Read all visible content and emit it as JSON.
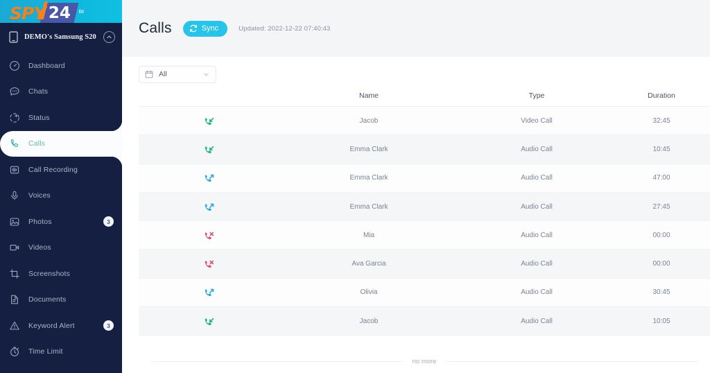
{
  "brand": {
    "logo_spy": "SPY",
    "logo_24": "24",
    "logo_superscript": "to",
    "logo_bg_color": "#11b6dd",
    "logo_spy_color": "#f5811f",
    "logo_badge_color": "#4857a8"
  },
  "sidebar": {
    "bg_color": "#151f42",
    "device": {
      "name": "DEMO's Samsung S20",
      "icon": "mobile-device-icon",
      "caret_icon": "chevron-up-icon"
    },
    "items": [
      {
        "label": "Dashboard",
        "icon": "dashboard-icon",
        "badge": "",
        "active": false
      },
      {
        "label": "Chats",
        "icon": "chat-bubble-icon",
        "badge": "",
        "active": false
      },
      {
        "label": "Status",
        "icon": "status-plus-icon",
        "badge": "",
        "active": false
      },
      {
        "label": "Calls",
        "icon": "phone-icon",
        "badge": "",
        "active": true
      },
      {
        "label": "Call Recording",
        "icon": "waveform-icon",
        "badge": "",
        "active": false
      },
      {
        "label": "Voices",
        "icon": "microphone-icon",
        "badge": "",
        "active": false
      },
      {
        "label": "Photos",
        "icon": "image-icon",
        "badge": "3",
        "active": false
      },
      {
        "label": "Videos",
        "icon": "video-camera-icon",
        "badge": "",
        "active": false
      },
      {
        "label": "Screenshots",
        "icon": "crop-icon",
        "badge": "",
        "active": false
      },
      {
        "label": "Documents",
        "icon": "document-icon",
        "badge": "",
        "active": false
      },
      {
        "label": "Keyword Alert",
        "icon": "warning-triangle-icon",
        "badge": "3",
        "active": false
      },
      {
        "label": "Time Limit",
        "icon": "stopwatch-icon",
        "badge": "",
        "active": false
      }
    ]
  },
  "header": {
    "title": "Calls",
    "sync_label": "Sync",
    "sync_icon": "refresh-icon",
    "sync_color": "#27c3e8",
    "updated_text": "Updated: 2022-12-22 07:40:43"
  },
  "filter": {
    "icon": "calendar-icon",
    "value": "All",
    "chevron_icon": "chevron-down-icon"
  },
  "table": {
    "columns": [
      "",
      "Name",
      "Type",
      "Duration"
    ],
    "rows": [
      {
        "direction": "incoming",
        "name": "Jacob",
        "type": "Video Call",
        "duration": "32:45"
      },
      {
        "direction": "incoming",
        "name": "Emma Clark",
        "type": "Audio Call",
        "duration": "10:45"
      },
      {
        "direction": "outgoing",
        "name": "Emma Clark",
        "type": "Audio Call",
        "duration": "47:00"
      },
      {
        "direction": "outgoing",
        "name": "Emma Clark",
        "type": "Audio Call",
        "duration": "27:45"
      },
      {
        "direction": "missed",
        "name": "Mia",
        "type": "Audio Call",
        "duration": "00:00"
      },
      {
        "direction": "missed",
        "name": "Ava Garcia",
        "type": "Audio Call",
        "duration": "00:00"
      },
      {
        "direction": "outgoing",
        "name": "Olivia",
        "type": "Audio Call",
        "duration": "30:45"
      },
      {
        "direction": "incoming",
        "name": "Jacob",
        "type": "Audio Call",
        "duration": "10:05"
      }
    ],
    "colors": {
      "incoming": "#1fb573",
      "outgoing": "#2aa8d8",
      "missed": "#d9506b"
    }
  },
  "footer": {
    "no_more_text": "no more"
  }
}
